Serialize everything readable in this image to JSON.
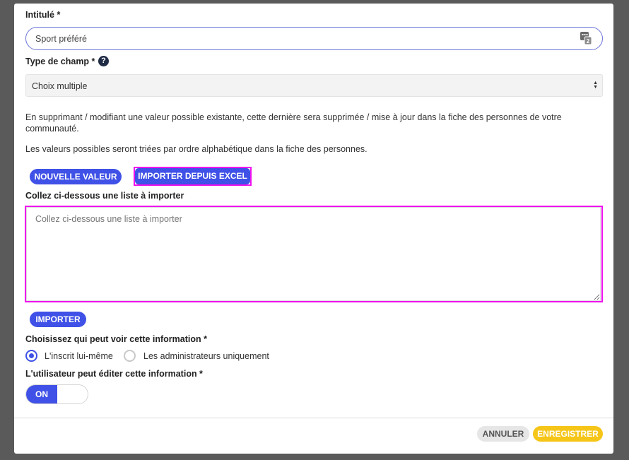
{
  "form": {
    "title_field": {
      "label": "Intitulé *",
      "value": "Sport préféré",
      "icon": "translate-icon"
    },
    "field_type": {
      "label": "Type de champ *",
      "help_icon": "?",
      "selected": "Choix multiple"
    },
    "info_text_1": "En supprimant / modifiant une valeur possible existante, cette dernière sera supprimée / mise à jour dans la fiche des personnes de votre communauté.",
    "info_text_2": "Les valeurs possibles seront triées par ordre alphabétique dans la fiche des personnes.",
    "buttons": {
      "new_value": "NOUVELLE VALEUR",
      "import_excel": "IMPORTER DEPUIS EXCEL",
      "import": "IMPORTER"
    },
    "paste_list": {
      "label": "Collez ci-dessous une liste à importer",
      "placeholder": "Collez ci-dessous une liste à importer",
      "value": ""
    },
    "visibility": {
      "label": "Choisissez qui peut voir cette information *",
      "options": [
        {
          "label": "L'inscrit lui-même",
          "selected": true
        },
        {
          "label": "Les administrateurs uniquement",
          "selected": false
        }
      ]
    },
    "editable": {
      "label": "L'utilisateur peut éditer cette information *",
      "toggle_label": "ON",
      "value": true
    }
  },
  "footer": {
    "cancel": "ANNULER",
    "save": "ENREGISTRER"
  },
  "colors": {
    "accent": "#3f51e6",
    "highlight": "#ee11ee",
    "save": "#f5c518",
    "cancel_bg": "#e6e6e6"
  }
}
